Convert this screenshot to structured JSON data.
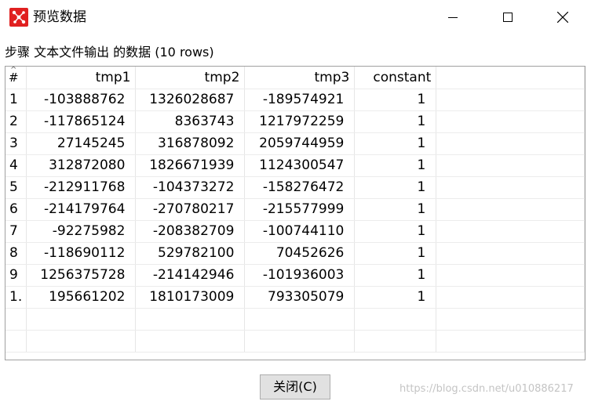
{
  "window": {
    "title": "预览数据",
    "icon": "app-logo-icon",
    "controls": {
      "minimize": "minimize-icon",
      "maximize": "maximize-icon",
      "close": "close-icon"
    }
  },
  "caption": "步骤 文本文件输出 的数据  (10 rows)",
  "table": {
    "index_header": "#",
    "columns": [
      "tmp1",
      "tmp2",
      "tmp3",
      "constant"
    ],
    "rows": [
      {
        "idx": "1",
        "cells": [
          "-103888762",
          "1326028687",
          "-189574921",
          "1"
        ]
      },
      {
        "idx": "2",
        "cells": [
          "-117865124",
          "8363743",
          "1217972259",
          "1"
        ]
      },
      {
        "idx": "3",
        "cells": [
          "27145245",
          "316878092",
          "2059744959",
          "1"
        ]
      },
      {
        "idx": "4",
        "cells": [
          "312872080",
          "1826671939",
          "1124300547",
          "1"
        ]
      },
      {
        "idx": "5",
        "cells": [
          "-212911768",
          "-104373272",
          "-158276472",
          "1"
        ]
      },
      {
        "idx": "6",
        "cells": [
          "-214179764",
          "-270780217",
          "-215577999",
          "1"
        ]
      },
      {
        "idx": "7",
        "cells": [
          "-92275982",
          "-208382709",
          "-100744110",
          "1"
        ]
      },
      {
        "idx": "8",
        "cells": [
          "-118690112",
          "529782100",
          "70452626",
          "1"
        ]
      },
      {
        "idx": "9",
        "cells": [
          "1256375728",
          "-214142946",
          "-101936003",
          "1"
        ]
      },
      {
        "idx": "1.",
        "cells": [
          "195661202",
          "1810173009",
          "793305079",
          "1"
        ]
      }
    ]
  },
  "close_button": "关闭(C)",
  "watermark": "https://blog.csdn.net/u010886217",
  "colors": {
    "icon_red": "#e02020",
    "button_bg": "#e1e1e1",
    "grid_border": "#a0a0a0"
  }
}
